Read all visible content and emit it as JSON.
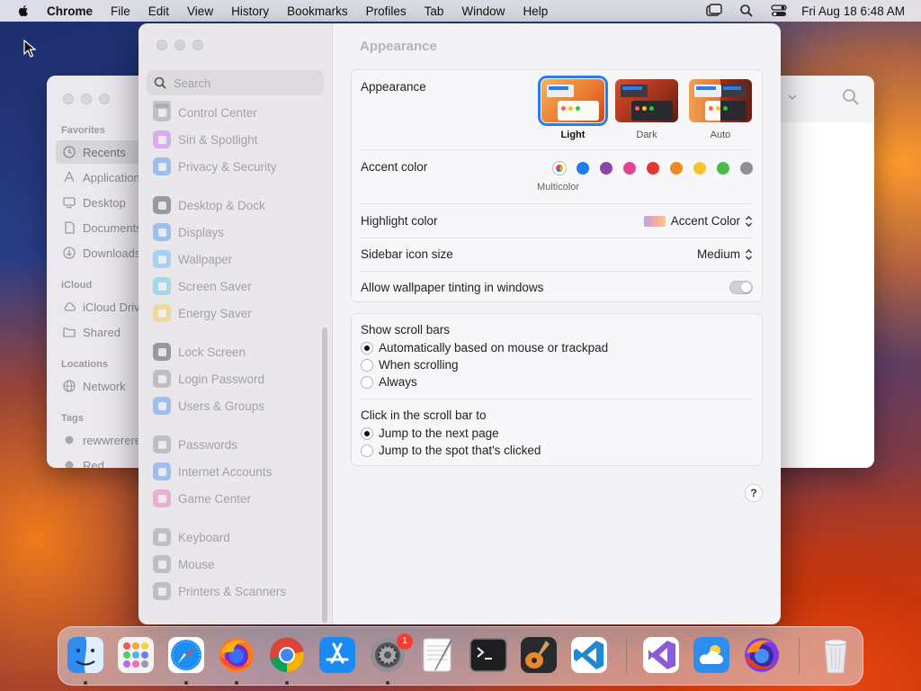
{
  "menubar": {
    "app_name": "Chrome",
    "items": [
      "File",
      "Edit",
      "View",
      "History",
      "Bookmarks",
      "Profiles",
      "Tab",
      "Window",
      "Help"
    ],
    "clock": "Fri Aug 18  6:48 AM"
  },
  "finder": {
    "sections": {
      "favorites": "Favorites",
      "icloud": "iCloud",
      "locations": "Locations",
      "tags": "Tags"
    },
    "favorites": [
      "Recents",
      "Applications",
      "Desktop",
      "Documents",
      "Downloads"
    ],
    "icloud": [
      "iCloud Drive",
      "Shared"
    ],
    "locations": [
      "Network"
    ],
    "tags": [
      "rewwrerere",
      "Red"
    ]
  },
  "settings": {
    "search_placeholder": "Search",
    "sidebar_items": [
      {
        "label": "Control Center",
        "icon": "control-center-icon",
        "color": "#8e8e93"
      },
      {
        "label": "Siri & Spotlight",
        "icon": "siri-icon",
        "color": "#c56be6"
      },
      {
        "label": "Privacy & Security",
        "icon": "hand-icon",
        "color": "#4a8cf7"
      },
      {
        "label": "Desktop & Dock",
        "icon": "dock-icon",
        "color": "#3a3a3c"
      },
      {
        "label": "Displays",
        "icon": "sun-icon",
        "color": "#4a8cf7"
      },
      {
        "label": "Wallpaper",
        "icon": "flower-icon",
        "color": "#53b6f5"
      },
      {
        "label": "Screen Saver",
        "icon": "screen-saver-icon",
        "color": "#4fc4e8"
      },
      {
        "label": "Energy Saver",
        "icon": "bulb-icon",
        "color": "#f6c744"
      },
      {
        "label": "Lock Screen",
        "icon": "lock-icon",
        "color": "#3a3a3c"
      },
      {
        "label": "Login Password",
        "icon": "key-icon",
        "color": "#8e8e93"
      },
      {
        "label": "Users & Groups",
        "icon": "users-icon",
        "color": "#4a8cf7"
      },
      {
        "label": "Passwords",
        "icon": "password-key-icon",
        "color": "#8e8e93"
      },
      {
        "label": "Internet Accounts",
        "icon": "at-icon",
        "color": "#4a8cf7"
      },
      {
        "label": "Game Center",
        "icon": "game-center-icon",
        "color": "#e96fae"
      },
      {
        "label": "Keyboard",
        "icon": "keyboard-icon",
        "color": "#8e8e93"
      },
      {
        "label": "Mouse",
        "icon": "mouse-icon",
        "color": "#8e8e93"
      },
      {
        "label": "Printers & Scanners",
        "icon": "printer-icon",
        "color": "#8e8e93"
      }
    ],
    "page_title": "Appearance",
    "appearance": {
      "label": "Appearance",
      "options": [
        "Light",
        "Dark",
        "Auto"
      ],
      "selected": "Light"
    },
    "accent": {
      "label": "Accent color",
      "colors": [
        "multicolor",
        "#1f7bf2",
        "#8e44ad",
        "#e84393",
        "#e0382e",
        "#f08a24",
        "#f6c52c",
        "#4cb94a",
        "#8e8e93"
      ],
      "selected_caption": "Multicolor"
    },
    "highlight": {
      "label": "Highlight color",
      "value": "Accent Color"
    },
    "sidebar_icon_size": {
      "label": "Sidebar icon size",
      "value": "Medium"
    },
    "wallpaper_tinting": {
      "label": "Allow wallpaper tinting in windows",
      "enabled": false
    },
    "scroll_bars": {
      "label": "Show scroll bars",
      "options": [
        "Automatically based on mouse or trackpad",
        "When scrolling",
        "Always"
      ],
      "selected": "Automatically based on mouse or trackpad"
    },
    "click_scroll_bar": {
      "label": "Click in the scroll bar to",
      "options": [
        "Jump to the next page",
        "Jump to the spot that's clicked"
      ],
      "selected": "Jump to the next page"
    },
    "help": "?"
  },
  "dock": {
    "apps": [
      "Finder",
      "Launchpad",
      "Safari",
      "Firefox",
      "Chrome",
      "App Store",
      "System Settings",
      "TextEdit",
      "Terminal",
      "GarageBand",
      "VS Code",
      "Visual Studio",
      "Weather",
      "Firefox Developer",
      "Trash"
    ],
    "settings_badge": "1"
  }
}
